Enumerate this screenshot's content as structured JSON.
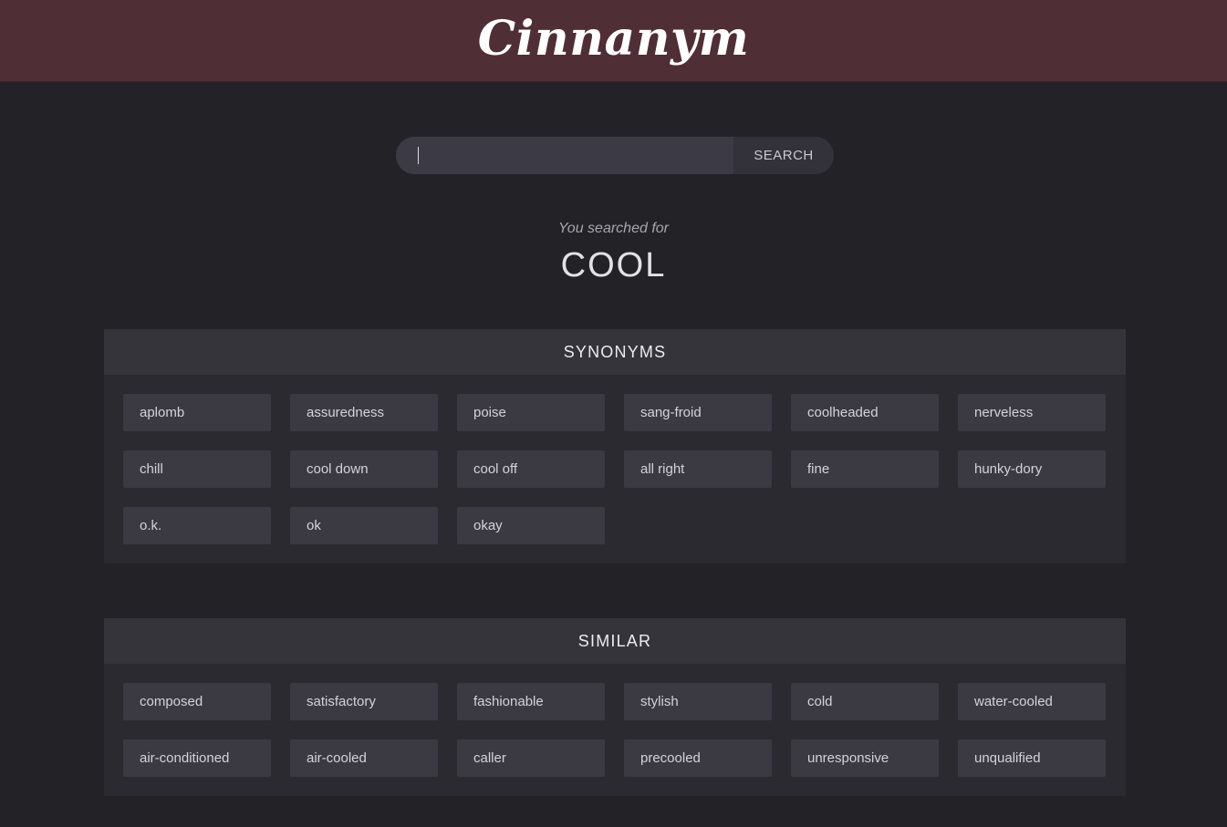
{
  "header": {
    "logo_text": "Cinnanym"
  },
  "search": {
    "value": "",
    "button_label": "SEARCH"
  },
  "result": {
    "searched_for_label": "You searched for",
    "query": "COOL"
  },
  "synonyms": {
    "title": "SYNONYMS",
    "items": [
      "aplomb",
      "assuredness",
      "poise",
      "sang-froid",
      "coolheaded",
      "nerveless",
      "chill",
      "cool down",
      "cool off",
      "all right",
      "fine",
      "hunky-dory",
      "o.k.",
      "ok",
      "okay"
    ]
  },
  "similar": {
    "title": "SIMILAR",
    "items": [
      "composed",
      "satisfactory",
      "fashionable",
      "stylish",
      "cold",
      "water-cooled",
      "air-conditioned",
      "air-cooled",
      "caller",
      "precooled",
      "unresponsive",
      "unqualified"
    ]
  },
  "colors": {
    "header_bg": "#4f2e35",
    "page_bg": "#232227",
    "chip_bg": "#3b3a43"
  }
}
